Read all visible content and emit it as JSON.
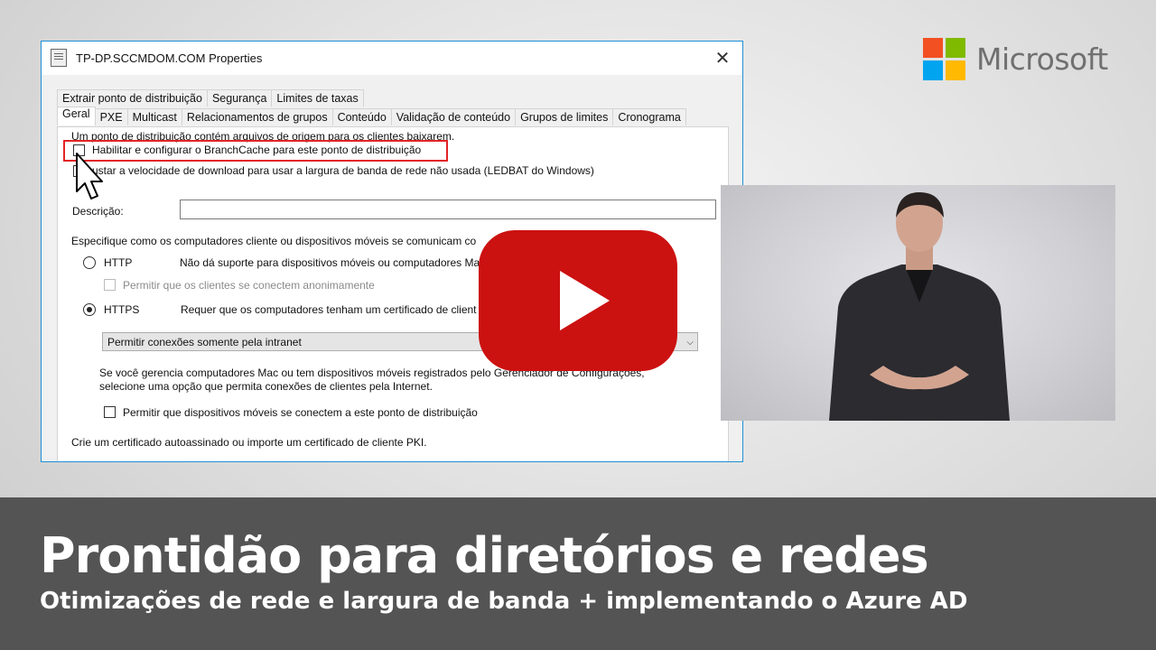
{
  "brand": {
    "name": "Microsoft",
    "logo_colors": [
      "#f25022",
      "#7fba00",
      "#00a4ef",
      "#ffb900"
    ]
  },
  "window": {
    "title": "TP-DP.SCCMDOM.COM Properties",
    "close_glyph": "✕",
    "tabs_row1": [
      "Extrair ponto de distribuição",
      "Segurança",
      "Limites de taxas"
    ],
    "tabs_row2": [
      "Geral",
      "PXE",
      "Multicast",
      "Relacionamentos de grupos",
      "Conteúdo",
      "Validação de conteúdo",
      "Grupos de limites",
      "Cronograma"
    ],
    "active_tab": "Geral",
    "intro": "Um ponto de distribuição contém arquivos de origem para os clientes baixarem.",
    "branchcache_label": "Habilitar e configurar o BranchCache para este ponto de distribuição",
    "ledbat_label": "ustar a velocidade de download para usar a largura de banda de rede não usada (LEDBAT do Windows)",
    "description_label": "Descrição:",
    "description_value": "",
    "comm_label": "Especifique como os computadores cliente ou dispositivos móveis se comunicam co",
    "http_label": "HTTP",
    "http_desc": "Não dá suporte para dispositivos móveis ou computadores Ma",
    "anon_label": "Permitir que os clientes se conectem anonimamente",
    "https_label": "HTTPS",
    "https_desc": "Requer que os computadores tenham um certificado de client",
    "selected_protocol": "HTTPS",
    "connection_select": "Permitir conexões somente pela intranet",
    "mac_note_line1": "Se você gerencia computadores Mac ou tem dispositivos móveis registrados pelo Gerenciador de Configurações,",
    "mac_note_line2": "selecione uma opção que permita conexões de clientes pela Internet.",
    "mobile_label": "Permitir que dispositivos móveis se conectem a este ponto de distribuição",
    "cert_label": "Crie um certificado autoassinado ou importe um certificado de cliente PKI."
  },
  "youtube": {
    "color": "#cc1111"
  },
  "banner": {
    "title": "Prontidão para diretórios e redes",
    "subtitle": "Otimizações de rede e largura de banda + implementando o Azure AD"
  }
}
